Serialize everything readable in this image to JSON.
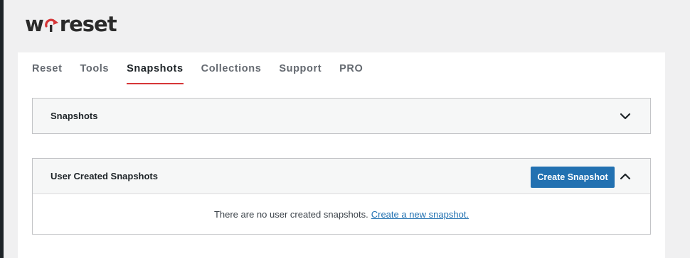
{
  "brand": {
    "logo_text_left": "w",
    "logo_text_right": "reset",
    "accent": "#d63638"
  },
  "tabs": [
    {
      "label": "Reset"
    },
    {
      "label": "Tools"
    },
    {
      "label": "Snapshots",
      "active": true
    },
    {
      "label": "Collections"
    },
    {
      "label": "Support"
    },
    {
      "label": "PRO"
    }
  ],
  "snapshots_card": {
    "title": "Snapshots",
    "toggle_icon": "chevron-down-icon"
  },
  "user_card": {
    "title": "User Created Snapshots",
    "create_button": "Create Snapshot",
    "toggle_icon": "chevron-up-icon",
    "empty_text": "There are no user created snapshots.",
    "empty_link": "Create a new snapshot."
  },
  "colors": {
    "primary_button": "#2271b1",
    "link": "#2271b1",
    "active_tab_underline": "#d63638"
  }
}
